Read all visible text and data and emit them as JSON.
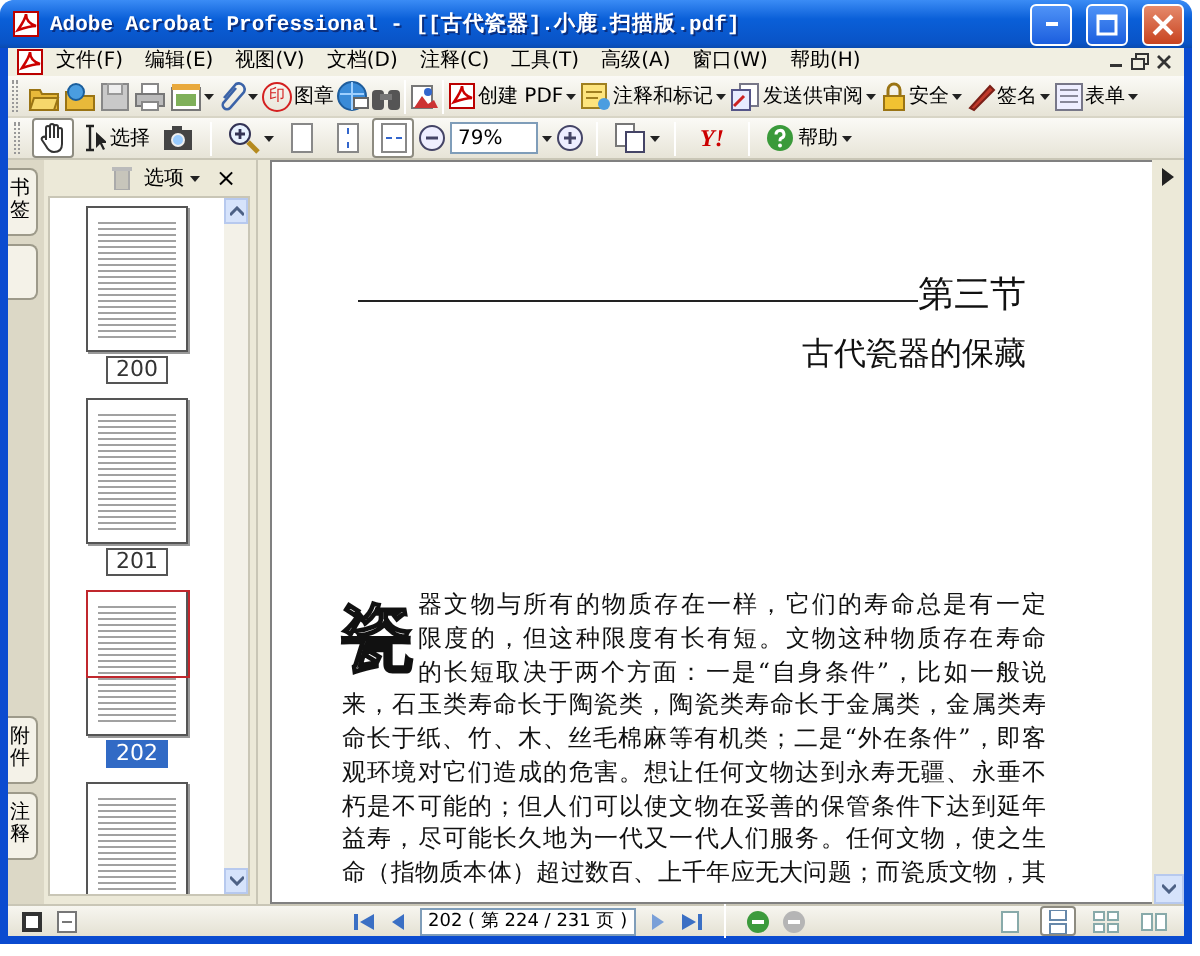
{
  "window": {
    "title": "Adobe Acrobat Professional - [[古代瓷器].小鹿.扫描版.pdf]"
  },
  "menu": [
    "文件(F)",
    "编辑(E)",
    "视图(V)",
    "文档(D)",
    "注释(C)",
    "工具(T)",
    "高级(A)",
    "窗口(W)",
    "帮助(H)"
  ],
  "toolbar_1": {
    "stamp_glyph": "印",
    "buttons": [
      "图章",
      "创建 PDF",
      "注释和标记",
      "发送供审阅",
      "安全",
      "签名",
      "表单"
    ]
  },
  "toolbar_2": {
    "tools": [
      {
        "selected": true
      },
      {
        "label": "选择",
        "selected": false
      },
      {
        "selected": false
      }
    ],
    "zoom_views": [
      {
        "selected": false
      },
      {
        "selected": false
      },
      {
        "selected": true
      }
    ],
    "zoom_value": "79%",
    "logo_text": "Y!",
    "help": "帮助"
  },
  "navigation_tabs": [
    {
      "label": "书签"
    },
    {
      "label": "附件"
    },
    {
      "label": "注释"
    }
  ],
  "thumbnail_panel": {
    "options": "选项",
    "close": "×",
    "pages": [
      {
        "label": "200",
        "selected": false
      },
      {
        "label": "201",
        "selected": false
      },
      {
        "label": "202",
        "selected": true
      },
      {
        "selected": false
      }
    ]
  },
  "document": {
    "section": "第三节",
    "title": "古代瓷器的保藏",
    "drop_cap": "瓷",
    "lines": [
      "器文物与所有的物质存在一样，它们的寿命总是有一定",
      "限度的，但这种限度有长有短。文物这种物质存在寿命",
      "的长短取决于两个方面：一是“自身条件”，比如一般说",
      "来，石玉类寿命长于陶瓷类，陶瓷类寿命长于金属类，金属类寿",
      "命长于纸、竹、木、丝毛棉麻等有机类；二是“外在条件”，即客",
      "观环境对它们造成的危害。想让任何文物达到永寿无疆、永垂不",
      "朽是不可能的；但人们可以使文物在妥善的保管条件下达到延年",
      "益寿，尽可能长久地为一代又一代人们服务。任何文物，使之生",
      "命（指物质本体）超过数百、上千年应无大问题；而瓷质文物，其"
    ]
  },
  "navigation": {
    "page_field": "202 ( 第 224 / 231 页 )",
    "page_layouts": [
      {
        "selected": false
      },
      {
        "selected": true
      },
      {
        "selected": false
      },
      {
        "selected": false
      }
    ]
  }
}
